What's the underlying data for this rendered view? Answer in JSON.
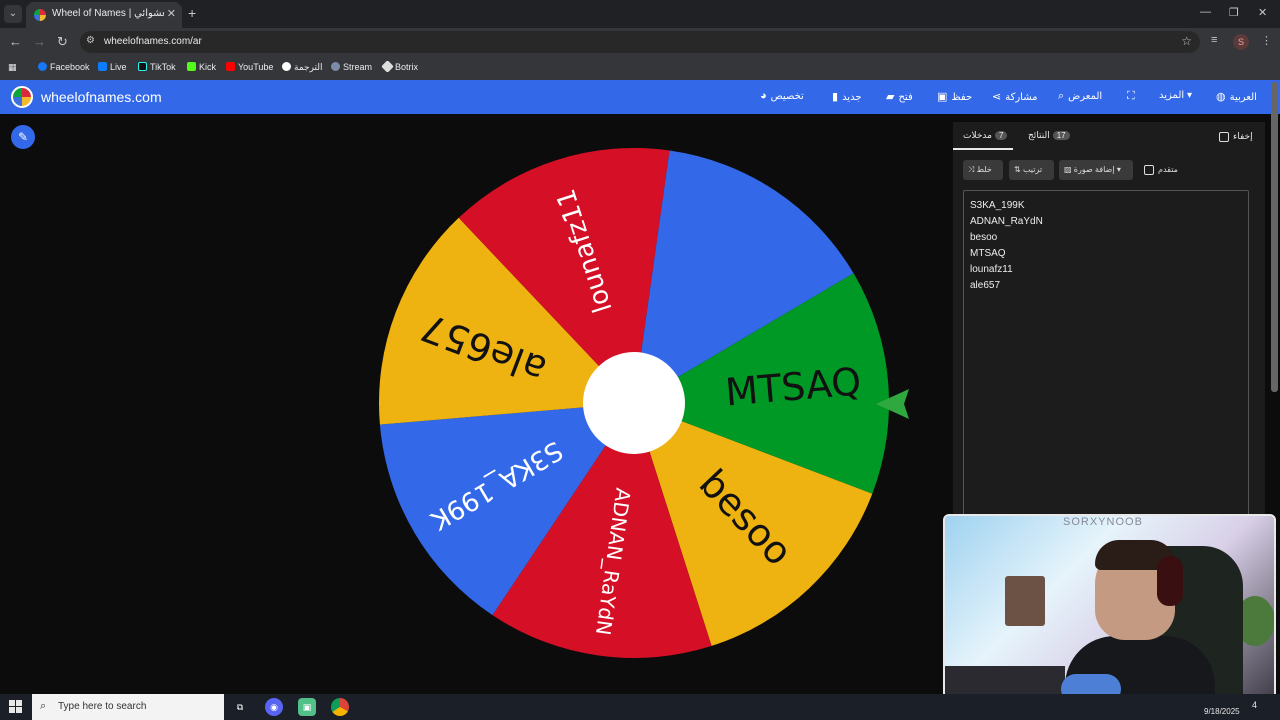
{
  "browser": {
    "tab_title": "Wheel of Names | اسم العشوائي",
    "url": "wheelofnames.com/ar",
    "profile_initial": "S",
    "bookmarks": [
      "Facebook",
      "Live",
      "TikTok",
      "Kick",
      "YouTube",
      "الترجمة",
      "Stream",
      "Botrix"
    ]
  },
  "app": {
    "logo": "wheelofnames.com",
    "menu": {
      "customize": "تخصيص",
      "new": "جديد",
      "open": "فتح",
      "save": "حفظ",
      "share": "مشاركة",
      "gallery": "المعرض",
      "more": "المزيد",
      "language": "العربية"
    }
  },
  "wheel": {
    "segments": [
      {
        "name": "",
        "color": "#3369e8"
      },
      {
        "name": "MTSAQ",
        "color": "#009925"
      },
      {
        "name": "besoo",
        "color": "#eeb211"
      },
      {
        "name": "ADNAN_RaYdN",
        "color": "#d50f25"
      },
      {
        "name": "S3KA_199K",
        "color": "#3369e8"
      },
      {
        "name": "ale657",
        "color": "#eeb211"
      },
      {
        "name": "lounafz11",
        "color": "#d50f25"
      }
    ],
    "pointer_color": "#2fa83f"
  },
  "panel": {
    "tab_entries": "مدخلات",
    "entries_count": "7",
    "tab_results": "النتائج",
    "results_count": "17",
    "hide_label": "إخفاء",
    "shuffle_label": "خلط",
    "sort_label": "ترتيب",
    "add_image_label": "إضافة صورة",
    "advanced_label": "متقدم",
    "entries": [
      "S3KA_199K",
      "ADNAN_RaYdN",
      "besoo",
      "MTSAQ",
      "lounafz11",
      "ale657"
    ]
  },
  "webcam": {
    "overlay_title": "SORXYNOOB"
  },
  "taskbar": {
    "search_placeholder": "Type here to search",
    "date": "9/18/2025",
    "notification_count": "4"
  }
}
